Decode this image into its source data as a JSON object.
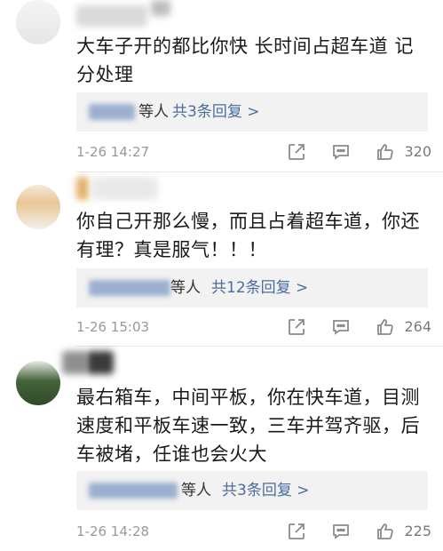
{
  "comments": [
    {
      "text": "大车子开的都比你快  长时间占超车道 记分处理",
      "reply_suffix": "等人",
      "reply_more": "共3条回复 >",
      "time": "1-26 14:27",
      "likes": "320"
    },
    {
      "text": "你自己开那么慢，而且占着超车道，你还有理？真是服气！！！",
      "reply_suffix": "等人",
      "reply_more": "共12条回复 >",
      "time": "1-26 15:03",
      "likes": "264"
    },
    {
      "text": "最右箱车，中间平板，你在快车道，目测速度和平板车速一致，三车并驾齐驱，后车被堵，任谁也会火大",
      "reply_suffix": "等人",
      "reply_more": "共3条回复 >",
      "time": "1-26 14:28",
      "likes": "225"
    }
  ],
  "icons": [
    "share-icon",
    "comment-icon",
    "like-icon"
  ],
  "colors": {
    "link": "#4a6d9c",
    "meta": "#999999",
    "reply_bg": "#f2f2f2"
  }
}
